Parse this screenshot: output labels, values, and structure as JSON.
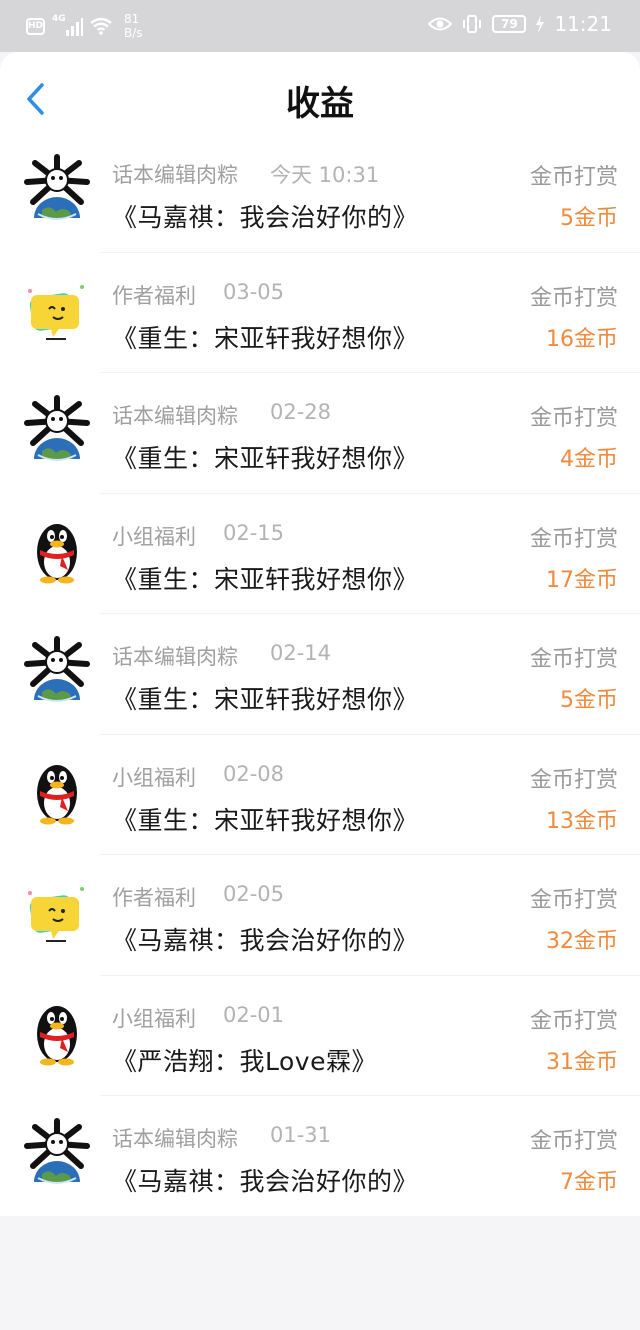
{
  "status_bar": {
    "hd": "HD",
    "network_type": "4G",
    "speed_value": "81",
    "speed_unit": "B/s",
    "battery": "79",
    "time": "11:21"
  },
  "header": {
    "title": "收益"
  },
  "rows": [
    {
      "sender": "话本编辑肉粽",
      "date": "今天 10:31",
      "story": "《马嘉祺：我会治好你的》",
      "reward_type": "金币打赏",
      "amount": "5金币",
      "avatar": "globe-skull-icon"
    },
    {
      "sender": "作者福利",
      "date": "03-05",
      "story": "《重生：宋亚轩我好想你》",
      "reward_type": "金币打赏",
      "amount": "16金币",
      "avatar": "chat-bubble-icon"
    },
    {
      "sender": "话本编辑肉粽",
      "date": "02-28",
      "story": "《重生：宋亚轩我好想你》",
      "reward_type": "金币打赏",
      "amount": "4金币",
      "avatar": "globe-skull-icon"
    },
    {
      "sender": "小组福利",
      "date": "02-15",
      "story": "《重生：宋亚轩我好想你》",
      "reward_type": "金币打赏",
      "amount": "17金币",
      "avatar": "penguin-icon"
    },
    {
      "sender": "话本编辑肉粽",
      "date": "02-14",
      "story": "《重生：宋亚轩我好想你》",
      "reward_type": "金币打赏",
      "amount": "5金币",
      "avatar": "globe-skull-icon"
    },
    {
      "sender": "小组福利",
      "date": "02-08",
      "story": "《重生：宋亚轩我好想你》",
      "reward_type": "金币打赏",
      "amount": "13金币",
      "avatar": "penguin-icon"
    },
    {
      "sender": "作者福利",
      "date": "02-05",
      "story": "《马嘉祺：我会治好你的》",
      "reward_type": "金币打赏",
      "amount": "32金币",
      "avatar": "chat-bubble-icon"
    },
    {
      "sender": "小组福利",
      "date": "02-01",
      "story": "《严浩翔：我Love霖》",
      "reward_type": "金币打赏",
      "amount": "31金币",
      "avatar": "penguin-icon"
    },
    {
      "sender": "话本编辑肉粽",
      "date": "01-31",
      "story": "《马嘉祺：我会治好你的》",
      "reward_type": "金币打赏",
      "amount": "7金币",
      "avatar": "globe-skull-icon"
    }
  ],
  "colors": {
    "accent_blue": "#2f8fe8",
    "amount_orange": "#f08a3c",
    "status_bar_bg": "#d6d6d8"
  }
}
